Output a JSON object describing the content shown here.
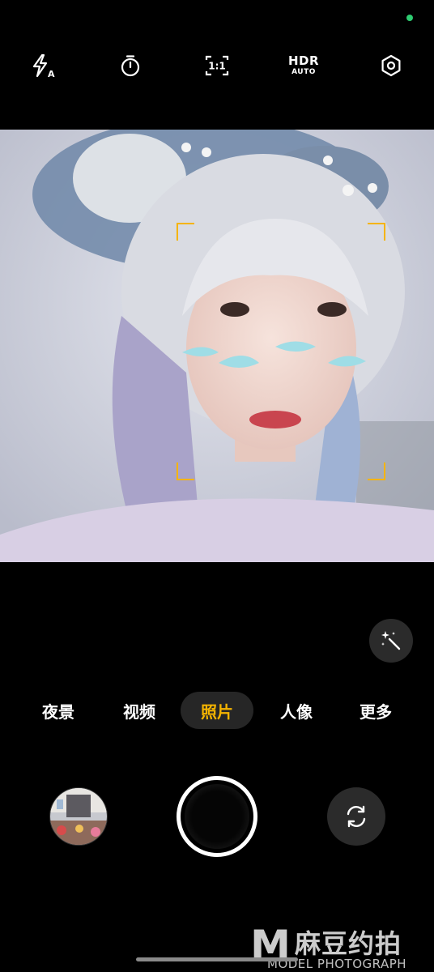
{
  "status": {
    "indicator_color": "#2ecc71"
  },
  "top_bar": {
    "flash": {
      "icon": "flash-auto-icon",
      "badge": "A"
    },
    "timer": {
      "icon": "timer-icon"
    },
    "aspect_ratio": {
      "icon": "aspect-ratio-icon",
      "label": "1:1"
    },
    "hdr": {
      "icon": "hdr-icon",
      "label": "HDR",
      "sub_label": "AUTO"
    },
    "settings": {
      "icon": "settings-hexagon-icon"
    }
  },
  "viewfinder": {
    "focus_color": "#f5b400"
  },
  "magic_button": {
    "icon": "magic-wand-icon"
  },
  "modes": {
    "items": [
      {
        "label": "夜景",
        "active": false
      },
      {
        "label": "视频",
        "active": false
      },
      {
        "label": "照片",
        "active": true
      },
      {
        "label": "人像",
        "active": false
      },
      {
        "label": "更多",
        "active": false
      }
    ],
    "active_color": "#f5b400"
  },
  "bottom": {
    "gallery": {
      "icon": "gallery-thumbnail"
    },
    "shutter": {
      "icon": "shutter-button"
    },
    "switch_camera": {
      "icon": "switch-camera-icon"
    }
  },
  "watermark": {
    "logo_letter": "M",
    "chinese": "麻豆约拍",
    "english": "MODEL PHOTOGRAPH"
  }
}
